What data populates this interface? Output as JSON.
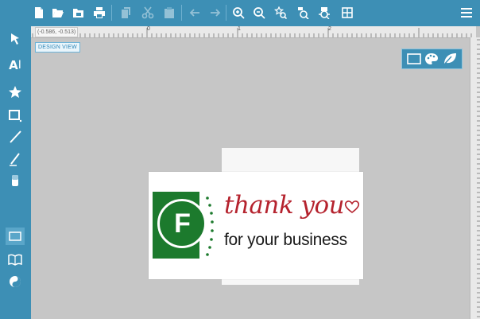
{
  "colors": {
    "toolbar_bg": "#3d8fb5",
    "canvas_bg": "#c6c6c6",
    "logo_green": "#1c7a2d",
    "script_red": "#b5232e"
  },
  "top_toolbar": {
    "icons": [
      "new-file-icon",
      "open-folder-icon",
      "save-folder-icon",
      "print-icon",
      "copy-icon",
      "cut-icon",
      "paste-icon",
      "undo-icon",
      "redo-icon",
      "zoom-in-icon",
      "zoom-out-icon",
      "zoom-fit-icon",
      "zoom-selection-icon",
      "zoom-page-icon",
      "grid-icon",
      "menu-icon"
    ]
  },
  "left_toolbar": {
    "text_tool_label": "A",
    "icons": [
      "select-arrow-icon",
      "text-tool-icon",
      "star-shape-icon",
      "rectangle-tool-icon",
      "line-tool-icon",
      "pen-tool-icon",
      "fill-tool-icon",
      "card-view-icon",
      "book-view-icon",
      "yin-yang-icon"
    ]
  },
  "ruler": {
    "coord_readout": "(-0.586, -0.513)",
    "ticks": [
      "0",
      "1",
      "2"
    ]
  },
  "view_label": "DESIGN VIEW",
  "mode_switch": {
    "icons": [
      "design-mode-icon",
      "palette-icon",
      "leaf-icon"
    ]
  },
  "card": {
    "logo_letter": "F",
    "line1": "thank you",
    "line2": "for your business"
  }
}
